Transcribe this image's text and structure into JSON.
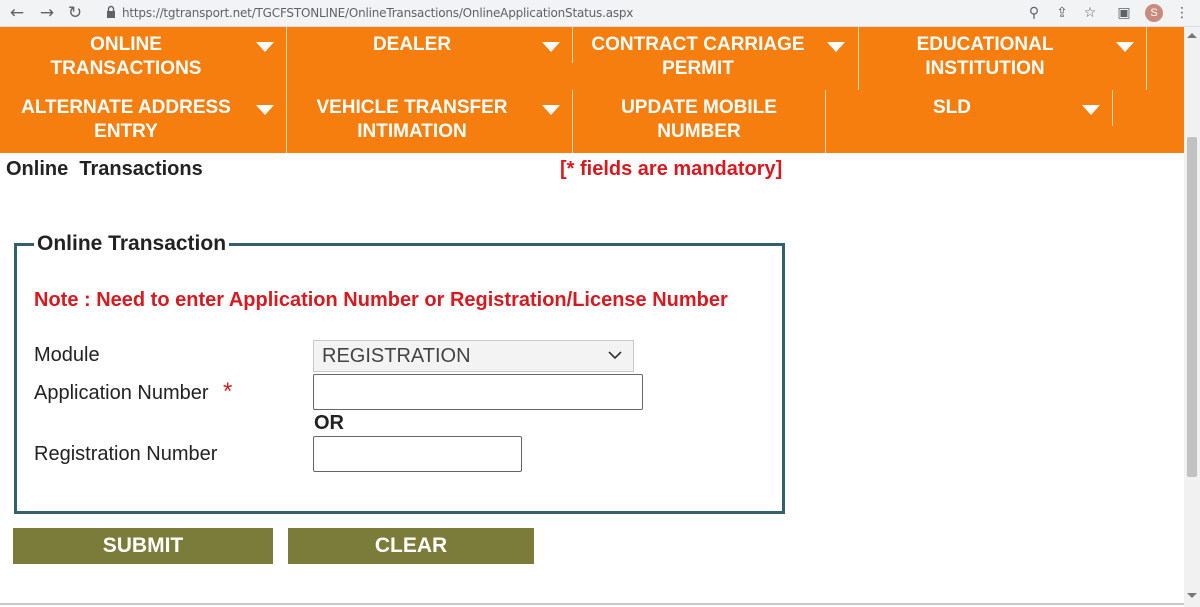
{
  "browser": {
    "url": "https://tgtransport.net/TGCFSTONLINE/OnlineTransactions/OnlineApplicationStatus.aspx",
    "icons": [
      "back-icon",
      "forward-icon",
      "reload-icon",
      "lock-icon",
      "zoom-icon",
      "share-icon",
      "star-icon",
      "extension-icon",
      "profile-avatar",
      "menu-icon"
    ],
    "avatar_letter": "S"
  },
  "nav": {
    "items": [
      {
        "line1": "ONLINE",
        "line2": "TRANSACTIONS"
      },
      {
        "line1": "DEALER",
        "line2": ""
      },
      {
        "line1": "CONTRACT CARRIAGE",
        "line2": "PERMIT"
      },
      {
        "line1": "EDUCATIONAL",
        "line2": "INSTITUTION"
      },
      {
        "line1": "ALTERNATE ADDRESS",
        "line2": "ENTRY"
      },
      {
        "line1": "VEHICLE TRANSFER",
        "line2": "INTIMATION"
      },
      {
        "line1": "UPDATE MOBILE",
        "line2": "NUMBER"
      },
      {
        "line1": "SLD",
        "line2": ""
      }
    ]
  },
  "page": {
    "breadcrumb": "Online  Transactions",
    "mandatory": "[* fields are mandatory]"
  },
  "form": {
    "legend": "Online Transaction",
    "note": "Note : Need to enter Application Number or Registration/License Number",
    "module_label": "Module",
    "module_value": "REGISTRATION",
    "application_label": "Application Number",
    "required_marker": "*",
    "or_text": "OR",
    "registration_label": "Registration Number",
    "submit": "SUBMIT",
    "clear": "CLEAR"
  },
  "colors": {
    "nav_bg": "#f57e0f",
    "mandatory_red": "#d71920",
    "fieldset_border": "#34606e",
    "button_bg": "#7c7c3a"
  }
}
